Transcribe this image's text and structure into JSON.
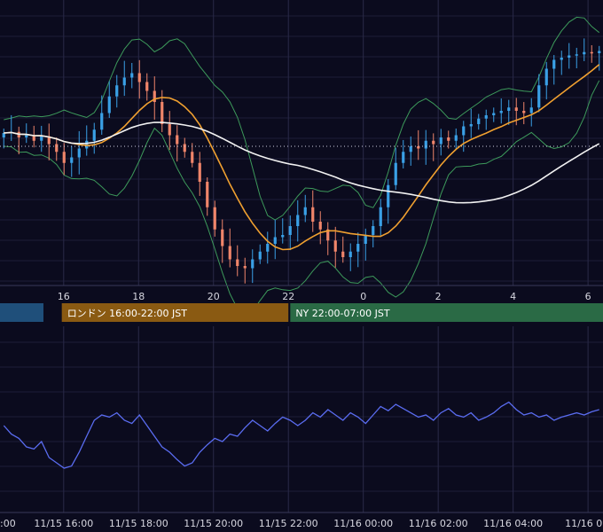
{
  "chart_data": [
    {
      "type": "candlestick",
      "panel": "price",
      "x_ticks": [
        {
          "h": 16,
          "label": "16"
        },
        {
          "h": 18,
          "label": "18"
        },
        {
          "h": 20,
          "label": "20"
        },
        {
          "h": 22,
          "label": "22"
        },
        {
          "h": 24,
          "label": "0"
        },
        {
          "h": 26,
          "label": "2"
        },
        {
          "h": 28,
          "label": "4"
        },
        {
          "h": 30,
          "label": "6"
        }
      ],
      "x_range": [
        14.3,
        30.4
      ],
      "y_range": [
        -1.0,
        1.0
      ],
      "grid": true,
      "reference_line": 0.0,
      "overlays": [
        {
          "kind": "bollinger",
          "color": "#3d9a5b"
        },
        {
          "kind": "moving_average",
          "color": "#f0a030"
        },
        {
          "kind": "moving_average",
          "color": "#f2f2f2"
        }
      ],
      "up_color": "#3aa0e6",
      "down_color": "#f0856a",
      "series_close": [
        0.12,
        0.13,
        0.08,
        0.1,
        0.05,
        0.09,
        0.02,
        -0.05,
        -0.15,
        -0.1,
        -0.02,
        0.05,
        0.15,
        0.3,
        0.45,
        0.55,
        0.62,
        0.66,
        0.58,
        0.5,
        0.4,
        0.2,
        0.1,
        0.02,
        -0.05,
        -0.15,
        -0.32,
        -0.55,
        -0.75,
        -0.9,
        -1.02,
        -1.08,
        -1.1,
        -1.02,
        -0.95,
        -0.88,
        -0.82,
        -0.8,
        -0.72,
        -0.62,
        -0.55,
        -0.68,
        -0.75,
        -0.85,
        -0.95,
        -1.0,
        -0.95,
        -0.88,
        -0.8,
        -0.72,
        -0.55,
        -0.35,
        -0.15,
        -0.05,
        0.0,
        -0.02,
        0.05,
        0.02,
        0.08,
        0.05,
        0.1,
        0.18,
        0.2,
        0.25,
        0.28,
        0.3,
        0.32,
        0.35,
        0.32,
        0.3,
        0.35,
        0.55,
        0.7,
        0.78,
        0.8,
        0.82,
        0.83,
        0.85,
        0.84,
        0.86
      ]
    },
    {
      "type": "line",
      "panel": "oscillator",
      "color": "#5a6cf0",
      "x_ticks": [
        {
          "h": 14,
          "label": ":00"
        },
        {
          "h": 16,
          "label": "11/15 16:00"
        },
        {
          "h": 18,
          "label": "11/15 18:00"
        },
        {
          "h": 20,
          "label": "11/15 20:00"
        },
        {
          "h": 22,
          "label": "11/15 22:00"
        },
        {
          "h": 24,
          "label": "11/16 00:00"
        },
        {
          "h": 26,
          "label": "11/16 02:00"
        },
        {
          "h": 28,
          "label": "11/16 04:00"
        },
        {
          "h": 30,
          "label": "11/16 06:0"
        }
      ],
      "x_range": [
        14.3,
        30.4
      ],
      "y_range": [
        0,
        100
      ],
      "grid": true,
      "values": [
        50,
        42,
        38,
        30,
        28,
        35,
        20,
        15,
        10,
        12,
        25,
        40,
        55,
        60,
        58,
        62,
        55,
        52,
        60,
        50,
        40,
        30,
        25,
        18,
        12,
        15,
        25,
        32,
        38,
        35,
        42,
        40,
        48,
        55,
        50,
        45,
        52,
        58,
        55,
        50,
        55,
        62,
        58,
        65,
        60,
        55,
        62,
        58,
        52,
        60,
        68,
        64,
        70,
        66,
        62,
        58,
        60,
        55,
        62,
        66,
        60,
        58,
        62,
        55,
        58,
        62,
        68,
        72,
        65,
        60,
        62,
        58,
        60,
        55,
        58,
        60,
        62,
        60,
        63,
        65
      ]
    }
  ],
  "sessions": [
    {
      "label": "",
      "color": "#1f4f7a"
    },
    {
      "label": "ロンドン 16:00-22:00 JST",
      "color": "#8a5a12"
    },
    {
      "label": "NY 22:00-07:00 JST",
      "color": "#2a6a45"
    }
  ]
}
